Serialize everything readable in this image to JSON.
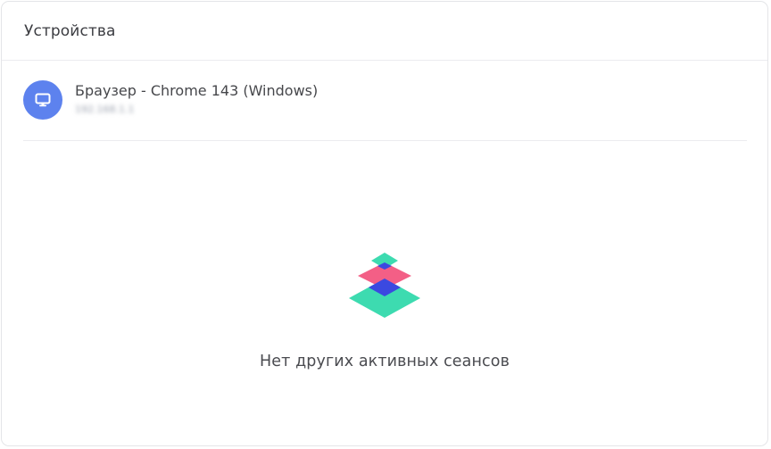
{
  "panel": {
    "title": "Устройства"
  },
  "devices": [
    {
      "icon": "monitor-icon",
      "name": "Браузер - Chrome 143 (Windows)",
      "ip": "192.168.1.1"
    }
  ],
  "empty_state": {
    "icon": "layers-icon",
    "message": "Нет других активных сеансов"
  },
  "colors": {
    "avatar_bg": "#5d82ee",
    "layer_green": "#3ddbb0",
    "layer_pink": "#f35f86",
    "layer_blue": "#3b49e0"
  }
}
